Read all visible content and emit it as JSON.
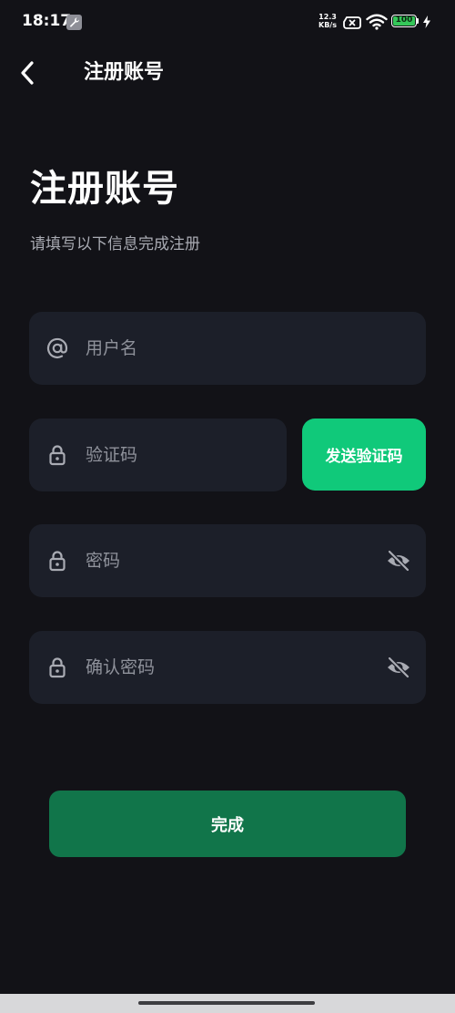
{
  "status_bar": {
    "time": "18:17",
    "net_speed_value": "12.3",
    "net_speed_unit": "KB/s",
    "battery_level": "100"
  },
  "app_bar": {
    "title": "注册账号"
  },
  "header": {
    "title": "注册账号",
    "subtitle": "请填写以下信息完成注册"
  },
  "form": {
    "username_placeholder": "用户名",
    "code_placeholder": "验证码",
    "password_placeholder": "密码",
    "confirm_password_placeholder": "确认密码",
    "send_code_label": "发送验证码",
    "submit_label": "完成"
  },
  "colors": {
    "background": "#121217",
    "field": "#1c1f29",
    "accent": "#10c97a",
    "submit": "#11754a"
  }
}
